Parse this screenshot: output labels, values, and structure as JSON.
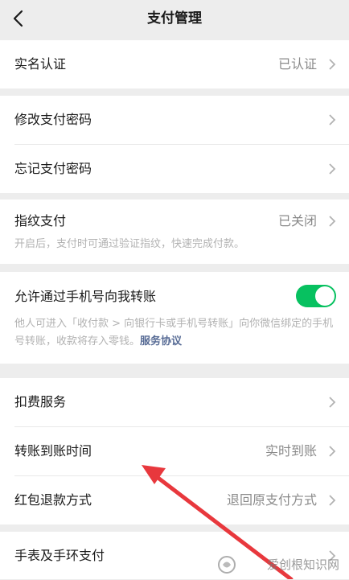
{
  "header": {
    "title": "支付管理"
  },
  "colors": {
    "accent": "#07c160",
    "link": "#576b95"
  },
  "sections": {
    "real_name": {
      "label": "实名认证",
      "value": "已认证"
    },
    "modify_password": {
      "label": "修改支付密码"
    },
    "forgot_password": {
      "label": "忘记支付密码"
    },
    "fingerprint": {
      "label": "指纹支付",
      "value": "已关闭",
      "note": "开启后，支付时可通过验证指纹，快速完成付款。"
    },
    "phone_transfer": {
      "label": "允许通过手机号向我转账",
      "enabled": true,
      "note": "他人可进入「收付款 > 向银行卡或手机号转账」向你微信绑定的手机号转账，收款将存入零钱。",
      "link": "服务协议"
    },
    "deduction": {
      "label": "扣费服务"
    },
    "transfer_time": {
      "label": "转账到账时间",
      "value": "实时到账"
    },
    "refund_method": {
      "label": "红包退款方式",
      "value": "退回原支付方式"
    },
    "watch_pay": {
      "label": "手表及手环支付"
    }
  },
  "watermark": {
    "text": "爱创根知识网"
  }
}
